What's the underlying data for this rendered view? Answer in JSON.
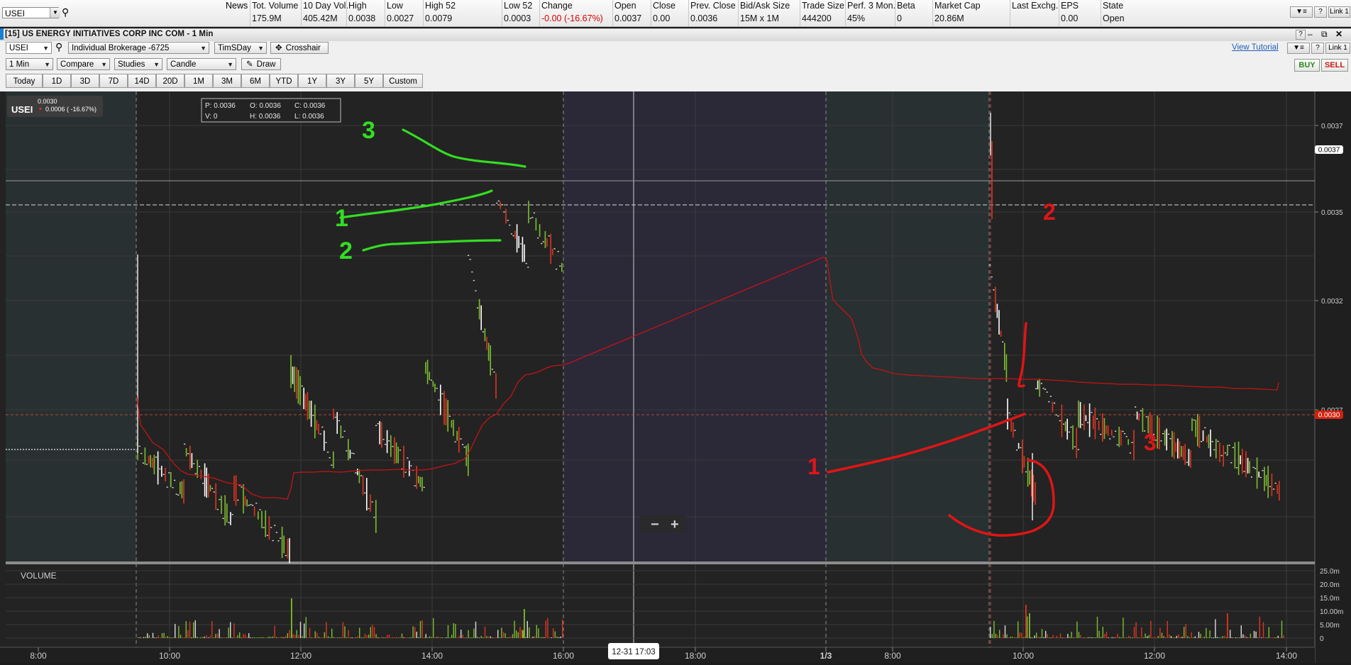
{
  "quote": {
    "symbol": "USEI",
    "news_label": "News",
    "fields": [
      {
        "label": "Tot. Volume",
        "value": "175.9M",
        "neg": false
      },
      {
        "label": "10 Day Vol.",
        "value": "405.42M",
        "neg": false
      },
      {
        "label": "High",
        "value": "0.0038",
        "neg": false
      },
      {
        "label": "Low",
        "value": "0.0027",
        "neg": false
      },
      {
        "label": "High 52",
        "value": "0.0079",
        "neg": false
      },
      {
        "label": "Low 52",
        "value": "0.0003",
        "neg": false
      },
      {
        "label": "Change",
        "value": "-0.00 (-16.67%)",
        "neg": true
      },
      {
        "label": "Open",
        "value": "0.0037",
        "neg": false
      },
      {
        "label": "Close",
        "value": "0.00",
        "neg": false
      },
      {
        "label": "Prev. Close",
        "value": "0.0036",
        "neg": false
      },
      {
        "label": "Bid/Ask Size",
        "value": "15M x 1M",
        "neg": false
      },
      {
        "label": "Trade Size",
        "value": "444200",
        "neg": false
      },
      {
        "label": "Perf. 3 Mon.",
        "value": "45%",
        "neg": false
      },
      {
        "label": "Beta",
        "value": "0",
        "neg": false
      },
      {
        "label": "Market Cap",
        "value": "20.86M",
        "neg": false
      },
      {
        "label": "Last Exchg.",
        "value": "",
        "neg": false
      },
      {
        "label": "EPS",
        "value": "0.00",
        "neg": false
      },
      {
        "label": "State",
        "value": "Open",
        "neg": false
      }
    ],
    "right_buttons": {
      "help": "?",
      "link": "Link 1"
    }
  },
  "window": {
    "title": "[15] US ENERGY INITIATIVES CORP INC COM - 1 Min",
    "controls": {
      "help": "?",
      "minimize": "–",
      "restore": "⧉",
      "close": "✕"
    }
  },
  "toolbar1": {
    "symbol": "USEI",
    "account": "Individual Brokerage -6725",
    "layout": "TimSDay",
    "crosshair": "Crosshair",
    "tutorial": "View Tutorial",
    "help": "?",
    "link": "Link 1",
    "buy": "BUY",
    "sell": "SELL"
  },
  "toolbar2": {
    "interval": "1 Min",
    "compare": "Compare",
    "studies": "Studies",
    "chart_type": "Candle",
    "draw": "Draw"
  },
  "ranges": [
    "Today",
    "1D",
    "3D",
    "7D",
    "14D",
    "20D",
    "1M",
    "3M",
    "6M",
    "YTD",
    "1Y",
    "3Y",
    "5Y",
    "Custom"
  ],
  "legend": {
    "symbol": "USEI",
    "last": "0.0030",
    "change": "0.0006 ( -16.67%)",
    "ohlc": {
      "p": "P: 0.0036",
      "o": "O: 0.0036",
      "c": "C: 0.0036",
      "v": "V: 0",
      "h": "H: 0.0036",
      "l": "L: 0.0036"
    }
  },
  "zoom": {
    "minus": "−",
    "plus": "+"
  },
  "volume_label": "VOLUME",
  "colors": {
    "up": "#7cbf2e",
    "down": "#e0351f",
    "vwap": "#c41414",
    "green_annotation": "#33dd22",
    "red_annotation": "#e01515",
    "price_marker": "#d4200c"
  },
  "chart_data": {
    "type": "candlestick",
    "interval": "1 Min",
    "price_axis": {
      "ticks": [
        "0.0037",
        "0.0035",
        "0.0032",
        "0.0027"
      ],
      "markers": [
        {
          "label": "0.0037",
          "color": "#ffffff"
        },
        {
          "label": "0.0030",
          "color": "#d4200c"
        }
      ]
    },
    "volume_axis": {
      "ticks": [
        "25.0m",
        "20.0m",
        "15.0m",
        "10.00m",
        "5.00m",
        "0"
      ]
    },
    "time_axis": {
      "ticks": [
        "8:00",
        "10:00",
        "12:00",
        "14:00",
        "16:00",
        "18:00",
        "1/3",
        "8:00",
        "10:00",
        "12:00",
        "14:00"
      ],
      "cursor_label": "12-31 17:03"
    },
    "annotations": {
      "green": [
        "3",
        "1",
        "2"
      ],
      "red": [
        "2",
        "1",
        "3"
      ]
    }
  }
}
